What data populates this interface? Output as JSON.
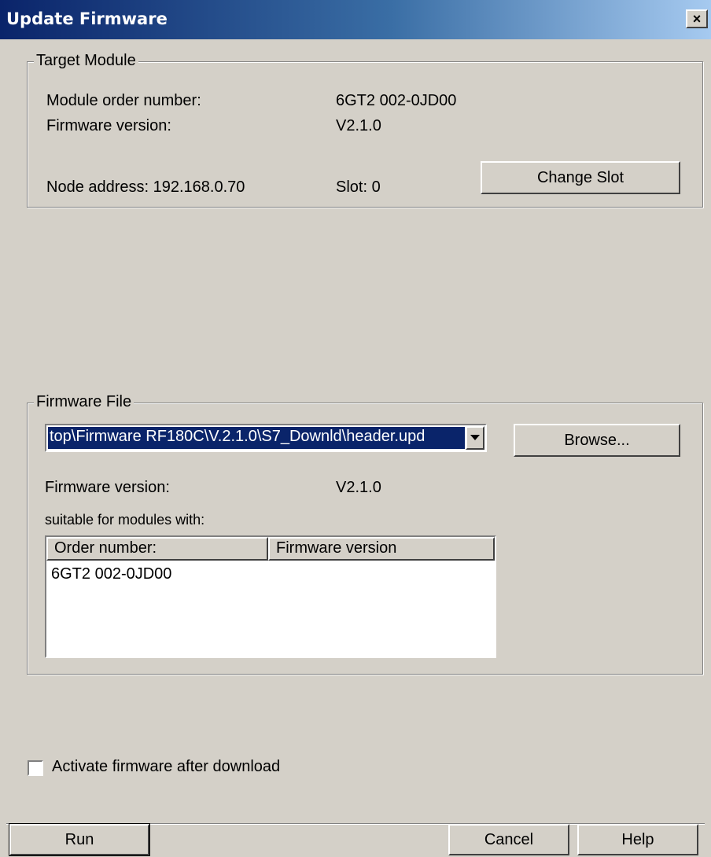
{
  "window": {
    "title": "Update Firmware",
    "close_label": "×"
  },
  "target_module": {
    "legend": "Target Module",
    "order_number_label": "Module order number:",
    "order_number_value": "6GT2 002-0JD00",
    "firmware_version_label": "Firmware version:",
    "firmware_version_value": "V2.1.0",
    "node_address": "Node address: 192.168.0.70",
    "slot": "Slot: 0",
    "change_slot_button": "Change Slot"
  },
  "firmware_file": {
    "legend": "Firmware File",
    "path": "top\\Firmware RF180C\\V.2.1.0\\S7_Downld\\header.upd",
    "browse_button": "Browse...",
    "firmware_version_label": "Firmware version:",
    "firmware_version_value": "V2.1.0",
    "suitable_label": "suitable for modules with:",
    "columns": [
      "Order number:",
      "Firmware version"
    ],
    "rows": [
      {
        "order_number": "6GT2 002-0JD00",
        "firmware_version": ""
      }
    ]
  },
  "activate": {
    "label": "Activate firmware after download",
    "checked": false
  },
  "buttons": {
    "run": "Run",
    "cancel": "Cancel",
    "help": "Help"
  },
  "colors": {
    "title_bar": "#0a246a",
    "dialog_bg": "#d4d0c8",
    "selection": "#0a246a"
  }
}
